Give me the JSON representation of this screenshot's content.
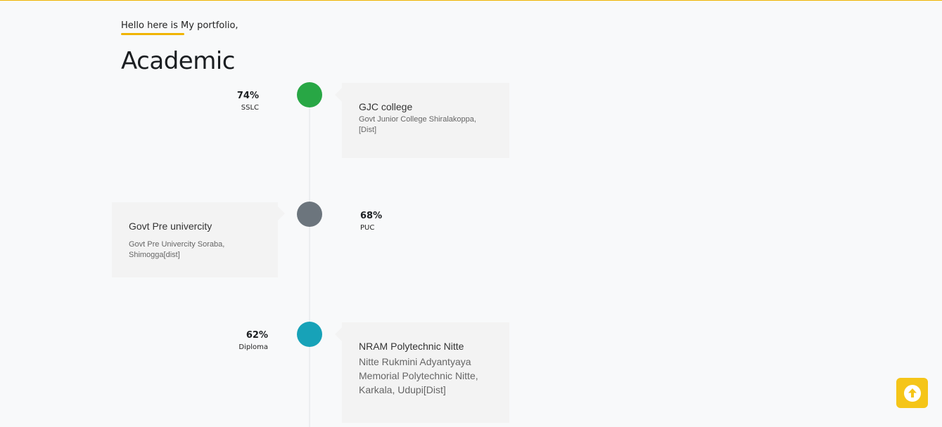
{
  "header": {
    "intro": "Hello here is My portfolio,",
    "title": "Academic"
  },
  "timeline": [
    {
      "percent": "74%",
      "level": "SSLC",
      "institution": "GJC college",
      "description": "Govt Junior College Shiralakoppa, [Dist]",
      "dot_color": "#28a745"
    },
    {
      "percent": "68%",
      "level": "PUC",
      "institution": "Govt Pre univercity",
      "description": "Govt Pre Univercity Soraba, Shimogga[dist]",
      "dot_color": "#6c757d"
    },
    {
      "percent": "62%",
      "level": "Diploma",
      "institution": "NRAM Polytechnic Nitte",
      "description": "Nitte Rukmini Adyantyaya Memorial Polytechnic Nitte, Karkala, Udupi[Dist]",
      "dot_color": "#17a2b8"
    }
  ],
  "colors": {
    "accent": "#f0b400",
    "scroll_button": "#f5c518"
  },
  "icons": {
    "scroll_top": "arrow-up-circle-icon"
  }
}
